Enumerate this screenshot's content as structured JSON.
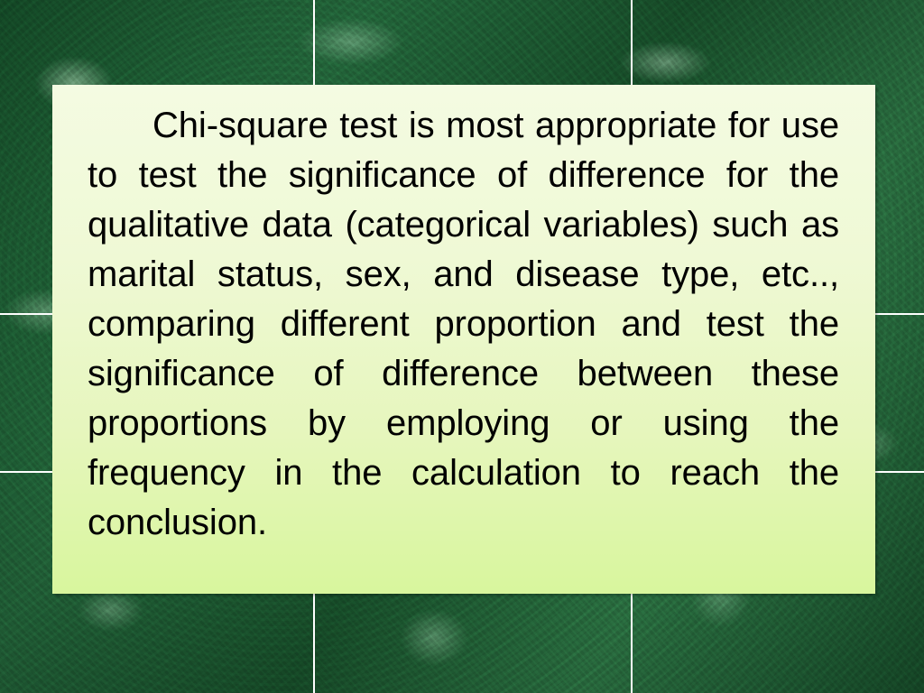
{
  "slide": {
    "background": {
      "style": "green-marble",
      "base_color": "#1d5c33",
      "highlight_color": "#bee4c4",
      "grid_line_color": "#ffffff"
    },
    "grid_lines": {
      "vertical_x": [
        348,
        700
      ],
      "horizontal_y": [
        348,
        523
      ]
    },
    "content_box": {
      "fill_top_color": "#f4fbe2",
      "fill_bottom_color": "#d8f69d",
      "text_color": "#000000",
      "body": "Chi-square test is most appropriate for use to test the significance of difference  for  the qualitative data (categorical variables) such as marital status, sex, and disease type, etc.., comparing different proportion and test the significance of difference between these proportions by employing or using the frequency in the calculation to reach the conclusion.",
      "lines": [
        "Chi-square test is most appropriate for use",
        "to test the significance of difference  for  the",
        "qualitative data (categorical variables) such as",
        "marital status, sex, and disease type, etc..,",
        "comparing different proportion and test the",
        "significance of difference between these",
        "proportions by employing or using the",
        "frequency in the calculation to reach the",
        "conclusion."
      ]
    }
  }
}
